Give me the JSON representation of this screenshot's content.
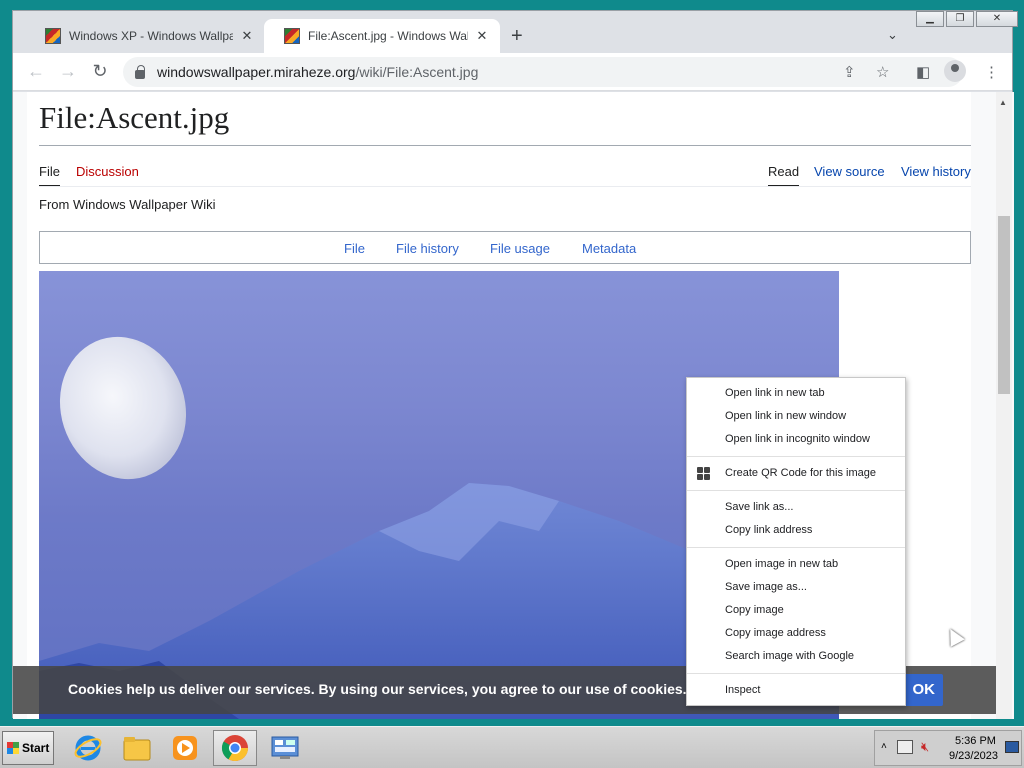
{
  "browser": {
    "tabs": [
      {
        "title": "Windows XP - Windows Wallpaper W",
        "active": false
      },
      {
        "title": "File:Ascent.jpg - Windows Wallpaper",
        "active": true
      }
    ],
    "url_host": "windowswallpaper.miraheze.org",
    "url_path": "/wiki/File:Ascent.jpg"
  },
  "page": {
    "title": "File:Ascent.jpg",
    "namespace_tabs": [
      "File",
      "Discussion"
    ],
    "view_tabs": [
      "Read",
      "View source",
      "View history"
    ],
    "from_line": "From Windows Wallpaper Wiki",
    "toc": [
      "File",
      "File history",
      "File usage",
      "Metadata"
    ]
  },
  "cookie_banner": {
    "text": "Cookies help us deliver our services. By using our services, you agree to our use of cookies.",
    "ok_label": "OK"
  },
  "context_menu": {
    "groups": [
      [
        "Open link in new tab",
        "Open link in new window",
        "Open link in incognito window"
      ],
      [
        "Create QR Code for this image"
      ],
      [
        "Save link as...",
        "Copy link address"
      ],
      [
        "Open image in new tab",
        "Save image as...",
        "Copy image",
        "Copy image address",
        "Search image with Google"
      ],
      [
        "Inspect"
      ]
    ]
  },
  "taskbar": {
    "start_label": "Start",
    "time": "5:36 PM",
    "date": "9/23/2023"
  }
}
